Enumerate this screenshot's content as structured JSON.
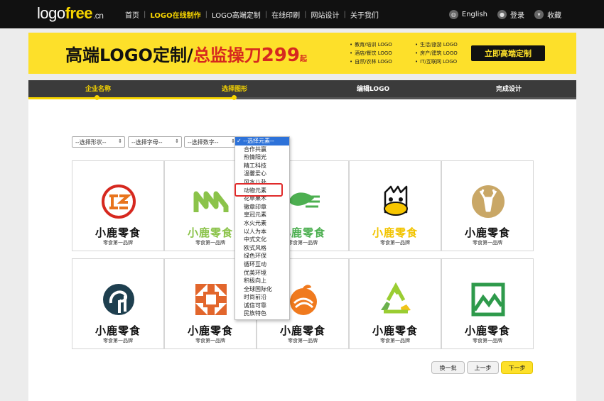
{
  "header": {
    "logo_main": "logo",
    "logo_free": "free",
    "logo_suffix": ".cn",
    "nav": [
      {
        "label": "首页",
        "active": false
      },
      {
        "label": "LOGO在线制作",
        "active": true
      },
      {
        "label": "LOGO高端定制",
        "active": false
      },
      {
        "label": "在线印刷",
        "active": false
      },
      {
        "label": "网站设计",
        "active": false
      },
      {
        "label": "关于我们",
        "active": false
      }
    ],
    "separator": "|",
    "english": "English",
    "login": "登录",
    "favorites": "收藏"
  },
  "banner": {
    "title_part1": "高端LOGO定制/",
    "title_part2": "总监操刀",
    "price": "299",
    "price_suffix": "起",
    "categories": [
      "教育/培训 LOGO",
      "生活/旅游 LOGO",
      "酒店/餐饮 LOGO",
      "房产/建筑 LOGO",
      "自然/农林 LOGO",
      "IT/互联网 LOGO"
    ],
    "cta": "立即高端定制"
  },
  "steps": [
    "企业名称",
    "选择图形",
    "编辑LOGO",
    "完成设计"
  ],
  "filters": {
    "shape": "--选择形状--",
    "letter": "--选择字母--",
    "number": "--选择数字--"
  },
  "dropdown": {
    "options": [
      "--选择元素--",
      "合作共赢",
      "热情阳光",
      "精工科技",
      "温馨爱心",
      "风水八卦",
      "动物元素",
      "花草果木",
      "徽章印章",
      "皇冠元素",
      "水火元素",
      "以人为本",
      "中式文化",
      "欧式风格",
      "绿色环保",
      "循环互动",
      "优美环境",
      "积极向上",
      "全球国际化",
      "时尚前沿",
      "诚信可靠",
      "民族特色"
    ],
    "selected_index": 0,
    "highlighted": "动物元素"
  },
  "cards": [
    {
      "brand": "小鹿零食",
      "tag": "零食第一品牌",
      "icon": "ring-letters-icon"
    },
    {
      "brand": "小鹿零食",
      "tag": "零食第一品牌",
      "icon": "zigzag-n-icon"
    },
    {
      "brand": "小鹿零食",
      "tag": "零食第一品牌",
      "icon": "leaf-wave-icon"
    },
    {
      "brand": "小鹿零食",
      "tag": "零食第一品牌",
      "icon": "duck-face-icon"
    },
    {
      "brand": "小鹿零食",
      "tag": "零食第一品牌",
      "icon": "deer-circle-icon"
    },
    {
      "brand": "小鹿零食",
      "tag": "零食第一品牌",
      "icon": "spiral-icon"
    },
    {
      "brand": "小鹿零食",
      "tag": "零食第一品牌",
      "icon": "square-cross-icon"
    },
    {
      "brand": "小鹿零食",
      "tag": "零食第一品牌",
      "icon": "orange-fruit-icon"
    },
    {
      "brand": "小鹿零食",
      "tag": "零食第一品牌",
      "icon": "recycle-triangle-icon"
    },
    {
      "brand": "小鹿零食",
      "tag": "零食第一品牌",
      "icon": "mountain-frame-icon"
    }
  ],
  "buttons": {
    "refresh": "换一批",
    "prev": "上一步",
    "next": "下一步"
  },
  "colors": {
    "accent": "#fde02a",
    "dark": "#111111",
    "red": "#d6281f"
  }
}
